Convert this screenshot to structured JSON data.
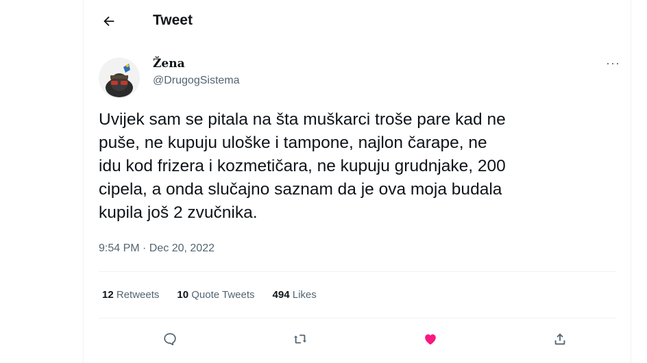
{
  "header": {
    "title": "Tweet",
    "back_icon": "arrow-left-icon"
  },
  "author": {
    "display_name": "Žena",
    "handle": "@DrugogSistema",
    "avatar_icon": "avatar-image"
  },
  "tweet": {
    "text": "Uvijek sam se pitala na šta muškarci troše pare kad ne\npuše, ne kupuju uloške i tampone, najlon čarape, ne\nidu kod frizera i kozmetičara, ne kupuju grudnjake, 200\ncipela, a onda slučajno saznam da je ova moja budala\nkupila još 2 zvučnika.",
    "timestamp": "9:54 PM · Dec 20, 2022"
  },
  "stats": {
    "retweets_count": "12",
    "retweets_label": "Retweets",
    "quotes_count": "10",
    "quotes_label": "Quote Tweets",
    "likes_count": "494",
    "likes_label": "Likes"
  },
  "actions": [
    {
      "icon": "reply-icon"
    },
    {
      "icon": "retweet-icon"
    },
    {
      "icon": "like-heart-icon",
      "liked": true
    },
    {
      "icon": "share-icon"
    }
  ],
  "colors": {
    "text": "#0f1419",
    "secondary": "#536471",
    "like": "#f91880",
    "divider": "#eff3f4"
  }
}
